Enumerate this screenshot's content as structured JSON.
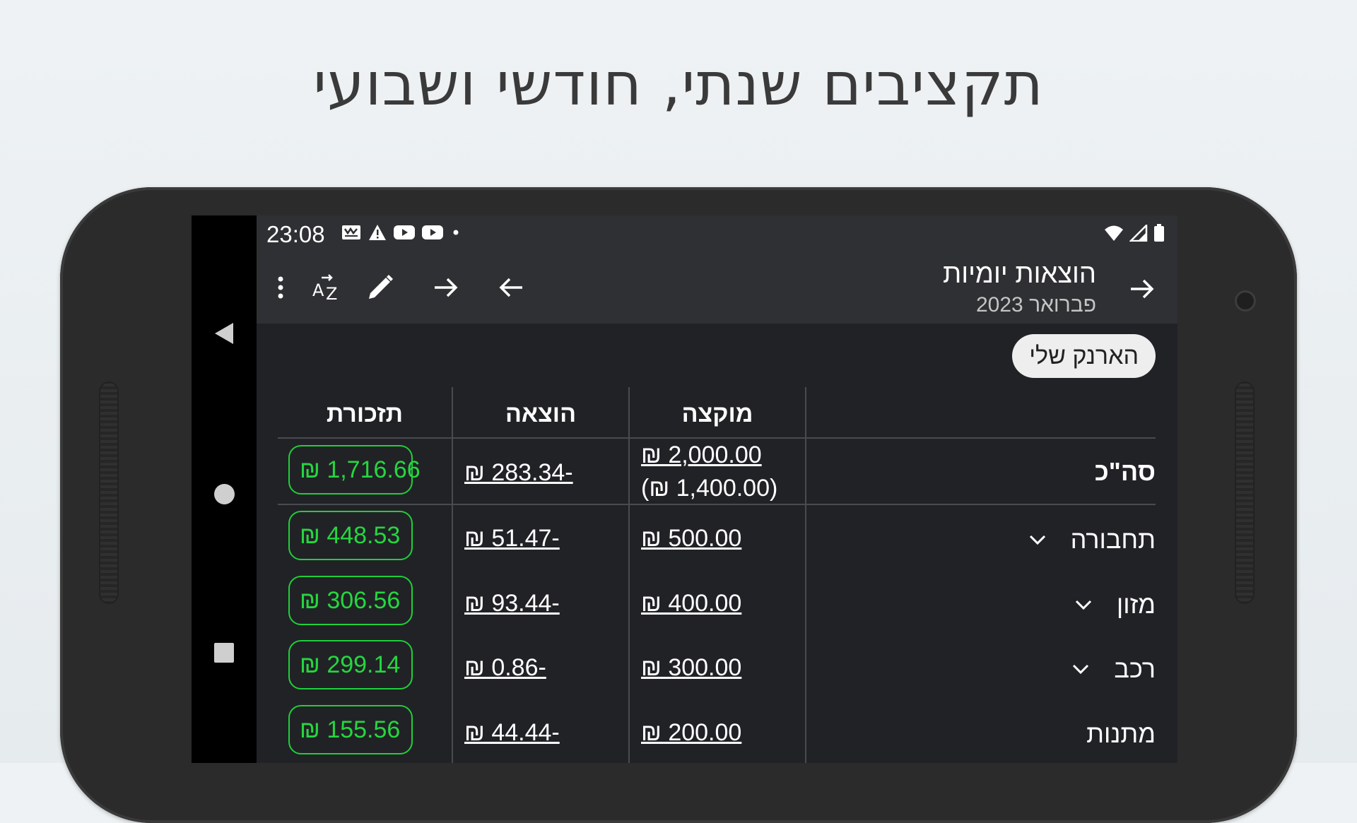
{
  "headline": "תקציבים שנתי, חודשי ושבועי",
  "status_bar": {
    "time": "23:08"
  },
  "appbar": {
    "title": "הוצאות יומיות",
    "subtitle": "פברואר 2023"
  },
  "chip": {
    "label": "הארנק שלי"
  },
  "table": {
    "headers": {
      "allocated": "מוקצה",
      "expense": "הוצאה",
      "balance": "תזכורת"
    },
    "total": {
      "label": "סה\"כ",
      "allocated": "₪ 2,000.00",
      "allocated_sub": "(₪ 1,400.00)",
      "expense": "₪ 283.34-",
      "balance": "₪ 1,716.66"
    },
    "rows": [
      {
        "label": "תחבורה",
        "allocated": "₪ 500.00",
        "expense": "₪ 51.47-",
        "balance": "₪ 448.53",
        "has_chevron": true
      },
      {
        "label": "מזון",
        "allocated": "₪ 400.00",
        "expense": "₪ 93.44-",
        "balance": "₪ 306.56",
        "has_chevron": true
      },
      {
        "label": "רכב",
        "allocated": "₪ 300.00",
        "expense": "₪ 0.86-",
        "balance": "₪ 299.14",
        "has_chevron": true
      },
      {
        "label": "מתנות",
        "allocated": "₪ 200.00",
        "expense": "₪ 44.44-",
        "balance": "₪ 155.56",
        "has_chevron": false
      }
    ]
  },
  "colors": {
    "background": "#212226",
    "appbar": "#2f3033",
    "positive": "#25d63f"
  },
  "icons": [
    "menu-icon",
    "sort-az-icon",
    "edit-icon",
    "arrow-right-icon",
    "arrow-left-icon",
    "back-arrow-icon",
    "chevron-down-icon"
  ]
}
